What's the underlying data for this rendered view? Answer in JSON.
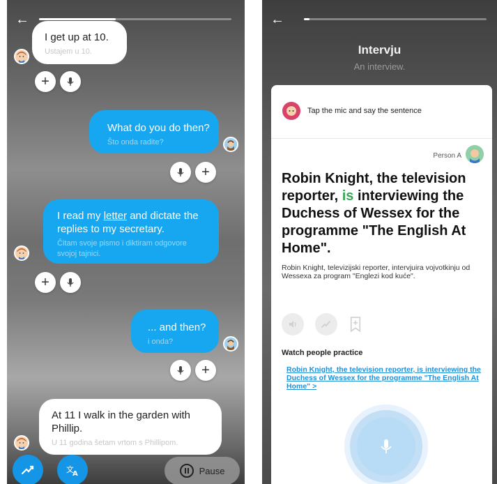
{
  "left_screen": {
    "progress_percent": 40,
    "messages": [
      {
        "speaker": "A",
        "main": "I get up at 10.",
        "sub": "Ustajem u 10."
      },
      {
        "speaker": "B",
        "main": "What do you do then?",
        "sub": "Što onda radite?"
      },
      {
        "speaker": "A",
        "main_before": "I read my ",
        "main_link": "letter",
        "main_after": " and dictate the replies to my secretary.",
        "sub": "Čitam svoje pismo i diktiram odgovore svojoj tajnici."
      },
      {
        "speaker": "B",
        "main": "... and then?",
        "sub": "i onda?"
      },
      {
        "speaker": "A",
        "main": "At 11 I walk in the garden with Phillip.",
        "sub": "U 11 godina šetam vrtom s Phillipom."
      }
    ],
    "buttons": {
      "add_glyph": "+",
      "pause_label": "Pause"
    },
    "icons": [
      "back-arrow-icon",
      "plus-icon",
      "mic-icon",
      "practice-icon",
      "translate-icon",
      "pause-icon"
    ],
    "accent_color": "#16a7f0"
  },
  "right_screen": {
    "progress_percent": 3,
    "title": "Intervju",
    "subtitle": "An interview.",
    "instruction": "Tap the mic and say the sentence",
    "person_label": "Person A",
    "sentence_before": "Robin Knight, the television reporter, ",
    "sentence_highlight": "is",
    "sentence_after": " interviewing the Duchess of Wessex for the programme \"The English At Home\".",
    "translation": "Robin Knight, televizijski reporter, intervjuira vojvotkinju od Wessexa za program \"Englezi kod kuće\".",
    "watch_title": "Watch people practice",
    "watch_link": "Robin Knight, the television reporter, is interviewing the Duchess of Wessex for the programme \"The English At Home\" >",
    "highlight_color": "#34a853",
    "link_color": "#1e90d8"
  }
}
